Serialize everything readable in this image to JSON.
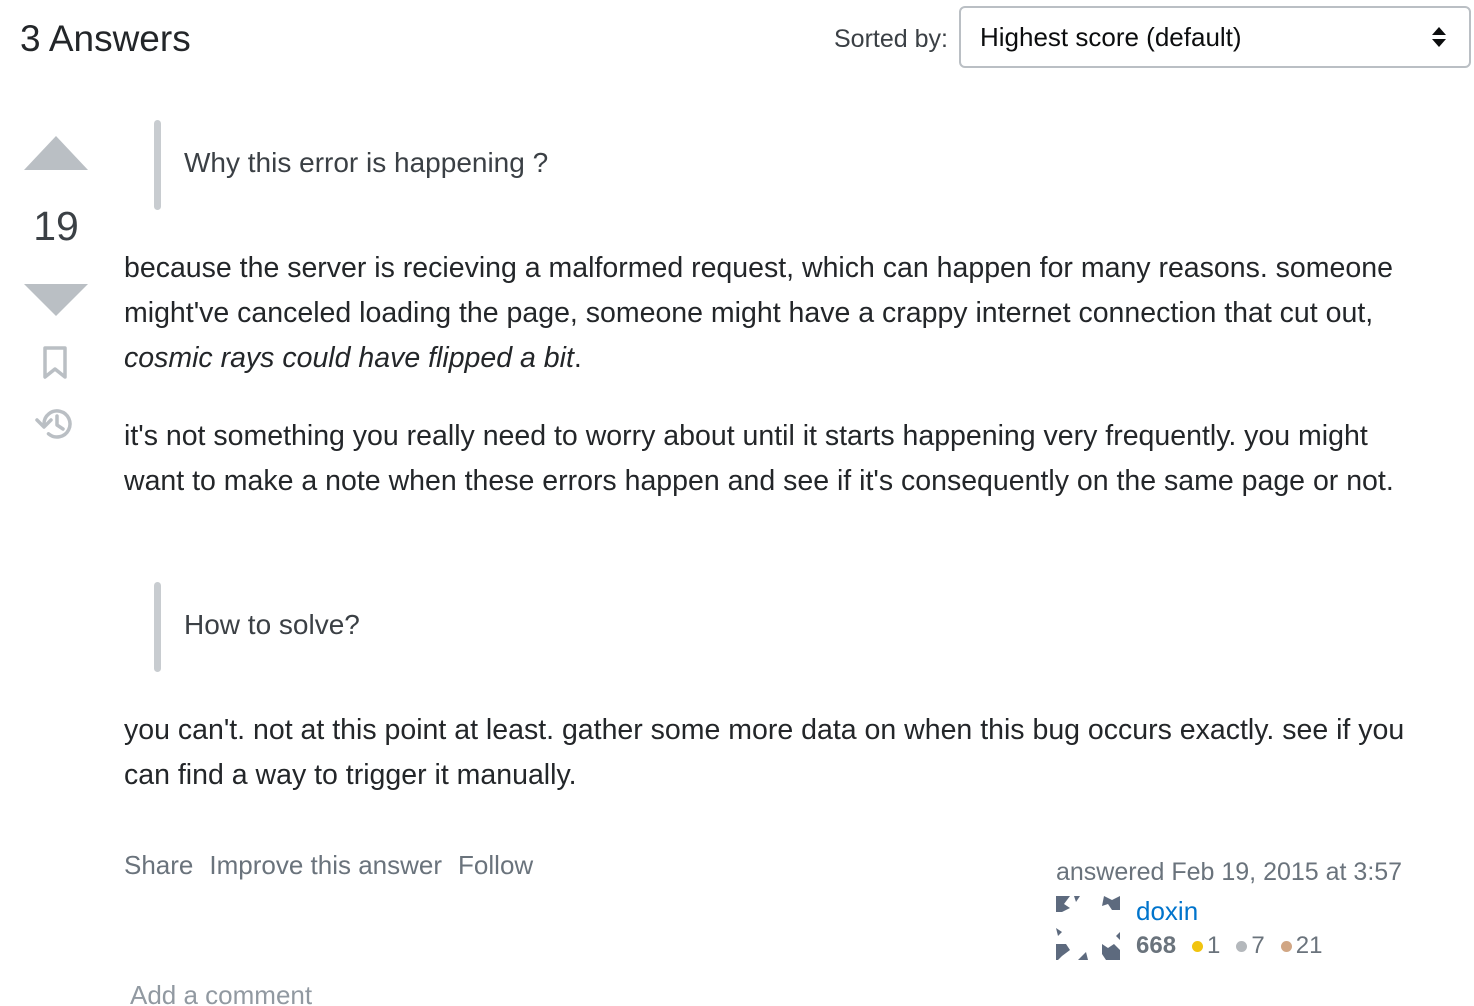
{
  "header": {
    "answers_title": "3 Answers",
    "sorted_label": "Sorted by:",
    "sort_value": "Highest score (default)"
  },
  "vote": {
    "count": "19"
  },
  "post": {
    "blockquote_1": "Why this error is happening ?",
    "para_1_a": "because the server is recieving a malformed request, which can happen for many reasons. someone might've canceled loading the page, someone might have a crappy internet connection that cut out, ",
    "para_1_em": "cosmic rays could have flipped a bit",
    "para_1_b": ".",
    "para_2": "it's not something you really need to worry about until it starts happening very frequently. you might want to make a note when these errors happen and see if it's consequently on the same page or not.",
    "blockquote_2": "How to solve?",
    "para_3": "you can't. not at this point at least. gather some more data on when this bug occurs exactly. see if you can find a way to trigger it manually."
  },
  "menu": {
    "share": "Share",
    "improve": "Improve this answer",
    "follow": "Follow"
  },
  "user": {
    "answered": "answered Feb 19, 2015 at 3:57",
    "name": "doxin",
    "reputation": "668",
    "gold": "1",
    "silver": "7",
    "bronze": "21",
    "colors": {
      "gold": "#f1c40f",
      "silver": "#b4b8bc",
      "bronze": "#d1a684"
    }
  },
  "comments": {
    "add_label": "Add a comment"
  }
}
